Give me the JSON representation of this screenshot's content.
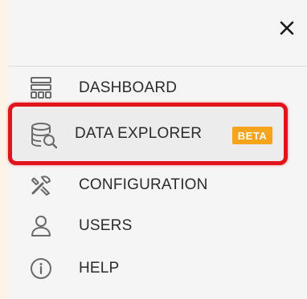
{
  "header": {
    "close_icon": "close-icon",
    "close_glyph": "✕"
  },
  "menu": {
    "items": [
      {
        "label": "DASHBOARD",
        "icon": "dashboard-icon"
      },
      {
        "label": "DATA EXPLORER",
        "icon": "database-search-icon",
        "badge": "BETA",
        "highlighted": true
      },
      {
        "label": "CONFIGURATION",
        "icon": "tools-icon"
      },
      {
        "label": "USERS",
        "icon": "user-icon"
      },
      {
        "label": "HELP",
        "icon": "info-icon"
      }
    ]
  },
  "colors": {
    "highlight_border": "#e0141a",
    "badge_bg": "#f4a51c",
    "text": "#2b2b2b"
  }
}
